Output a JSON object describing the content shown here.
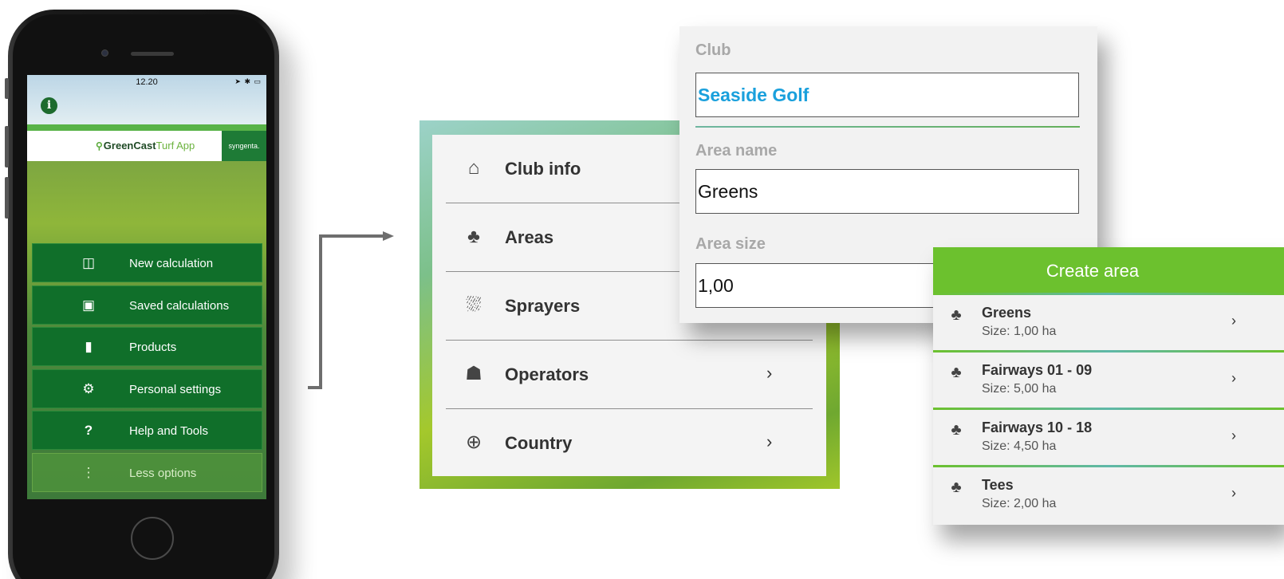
{
  "phone": {
    "status_time": "12.20",
    "status_icons": "➤ ✱ ▭",
    "info_icon": "info-icon",
    "brand_name": "GreenCast",
    "brand_suffix": "Turf App",
    "partner_logo": "syngenta.",
    "menu": [
      {
        "label": "New calculation",
        "icon": "calculator-icon",
        "glyph": "◫"
      },
      {
        "label": "Saved calculations",
        "icon": "saved-calculator-icon",
        "glyph": "▣"
      },
      {
        "label": "Products",
        "icon": "product-icon",
        "glyph": "▮"
      },
      {
        "label": "Personal settings",
        "icon": "gear-icon",
        "glyph": "⚙"
      },
      {
        "label": "Help and Tools",
        "icon": "question-icon",
        "glyph": "?"
      },
      {
        "label": "Less options",
        "icon": "more-vertical-icon",
        "glyph": "⋮"
      }
    ]
  },
  "settings_menu": [
    {
      "label": "Club info",
      "icon": "home-icon",
      "glyph": "⌂",
      "chevron": ""
    },
    {
      "label": "Areas",
      "icon": "trees-icon",
      "glyph": "♣",
      "chevron": ""
    },
    {
      "label": "Sprayers",
      "icon": "sprayer-icon",
      "glyph": "⛆",
      "chevron": ""
    },
    {
      "label": "Operators",
      "icon": "operators-icon",
      "glyph": "☗",
      "chevron": "›"
    },
    {
      "label": "Country",
      "icon": "globe-icon",
      "glyph": "⊕",
      "chevron": "›"
    }
  ],
  "club_form": {
    "club_label": "Club",
    "club_value": "Seaside Golf",
    "area_name_label": "Area name",
    "area_name_value": "Greens",
    "area_size_label": "Area size",
    "area_size_value": "1,00"
  },
  "create_area": {
    "title": "Create area",
    "areas": [
      {
        "name": "Greens",
        "size": "Size: 1,00 ha",
        "icon": "trees-icon",
        "glyph": "♣",
        "chevron": "›"
      },
      {
        "name": "Fairways 01 - 09",
        "size": "Size: 5,00 ha",
        "icon": "trees-icon",
        "glyph": "♣",
        "chevron": "›"
      },
      {
        "name": "Fairways 10 - 18",
        "size": "Size: 4,50 ha",
        "icon": "trees-icon",
        "glyph": "♣",
        "chevron": "›"
      },
      {
        "name": "Tees",
        "size": "Size: 2,00 ha",
        "icon": "trees-icon",
        "glyph": "♣",
        "chevron": "›"
      }
    ]
  },
  "colors": {
    "accent_green": "#6cc12e",
    "menu_green": "#106f2a",
    "club_blue": "#1aa0dc"
  }
}
